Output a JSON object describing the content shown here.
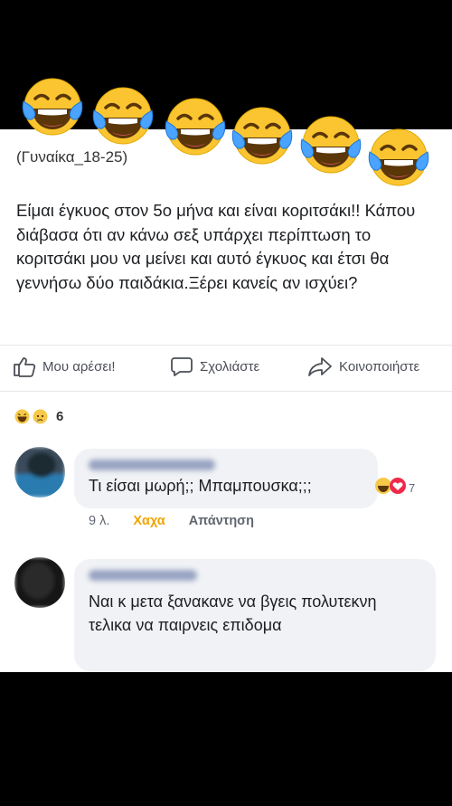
{
  "post": {
    "group_name": "(Γυναίκα_18-25)",
    "text": "Είμαι έγκυος στον 5ο μήνα και είναι κοριτσάκι!! Κάπου διάβασα ότι αν κάνω σεξ υπάρχει περίπτωση το κοριτσάκι μου να μείνει και αυτό έγκυος και έτσι θα γεννήσω δύο παιδάκια.Ξέρει κανείς αν ισχύει?"
  },
  "actions": {
    "like_label": "Μου αρέσει!",
    "comment_label": "Σχολιάστε",
    "share_label": "Κοινοποιήστε"
  },
  "reactions": {
    "count": "6",
    "types": [
      "haha-icon",
      "sad-icon"
    ]
  },
  "comments": [
    {
      "text": "Τι είσαι μωρή;; Μπαμπουσκα;;;",
      "time": "9 λ.",
      "reaction_label": "Χαχα",
      "reply_label": "Απάντηση",
      "reaction_count": "7"
    },
    {
      "text": "Ναι κ μετα ξανακανε να βγεις πολυτεκνη τελικα να παιρνεις επιδομα"
    }
  ],
  "overlay": {
    "emoji": "laughing-tears-icon",
    "emoji_count": 6
  },
  "colors": {
    "background": "#000000",
    "card": "#ffffff",
    "bubble": "#f0f2f5",
    "haha_accent": "#f0a500"
  }
}
